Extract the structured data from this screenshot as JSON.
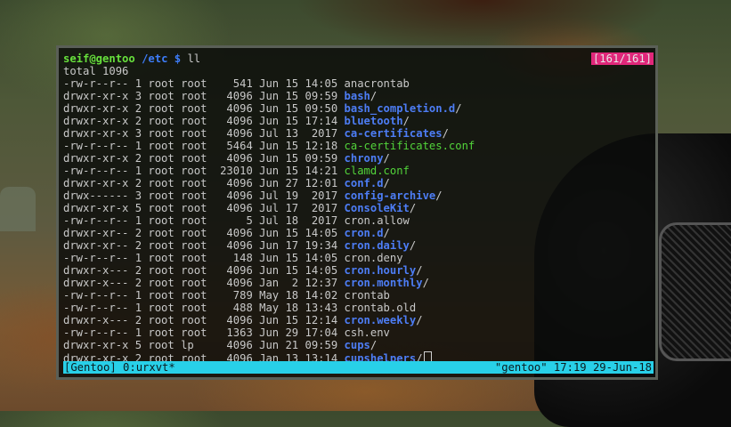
{
  "prompt": {
    "user": "seif@gentoo",
    "path": "/etc $",
    "command": "ll"
  },
  "counter": "[161/161]",
  "total": "total 1096",
  "listing": [
    {
      "meta": "-rw-r--r-- 1 root root    541 Jun 15 14:05 ",
      "name": "anacrontab",
      "suffix": "",
      "type": "file"
    },
    {
      "meta": "drwxr-xr-x 3 root root   4096 Jun 15 09:59 ",
      "name": "bash",
      "suffix": "/",
      "type": "dir"
    },
    {
      "meta": "drwxr-xr-x 2 root root   4096 Jun 15 09:50 ",
      "name": "bash_completion.d",
      "suffix": "/",
      "type": "dir"
    },
    {
      "meta": "drwxr-xr-x 2 root root   4096 Jun 15 17:14 ",
      "name": "bluetooth",
      "suffix": "/",
      "type": "dir"
    },
    {
      "meta": "drwxr-xr-x 3 root root   4096 Jul 13  2017 ",
      "name": "ca-certificates",
      "suffix": "/",
      "type": "dir"
    },
    {
      "meta": "-rw-r--r-- 1 root root   5464 Jun 15 12:18 ",
      "name": "ca-certificates.conf",
      "suffix": "",
      "type": "green"
    },
    {
      "meta": "drwxr-xr-x 2 root root   4096 Jun 15 09:59 ",
      "name": "chrony",
      "suffix": "/",
      "type": "dir"
    },
    {
      "meta": "-rw-r--r-- 1 root root  23010 Jun 15 14:21 ",
      "name": "clamd.conf",
      "suffix": "",
      "type": "green"
    },
    {
      "meta": "drwxr-xr-x 2 root root   4096 Jun 27 12:01 ",
      "name": "conf.d",
      "suffix": "/",
      "type": "dir"
    },
    {
      "meta": "drwx------ 3 root root   4096 Jul 19  2017 ",
      "name": "config-archive",
      "suffix": "/",
      "type": "dir"
    },
    {
      "meta": "drwxr-xr-x 5 root root   4096 Jul 17  2017 ",
      "name": "ConsoleKit",
      "suffix": "/",
      "type": "dir"
    },
    {
      "meta": "-rw-r--r-- 1 root root      5 Jul 18  2017 ",
      "name": "cron.allow",
      "suffix": "",
      "type": "file"
    },
    {
      "meta": "drwxr-xr-- 2 root root   4096 Jun 15 14:05 ",
      "name": "cron.d",
      "suffix": "/",
      "type": "dir"
    },
    {
      "meta": "drwxr-xr-- 2 root root   4096 Jun 17 19:34 ",
      "name": "cron.daily",
      "suffix": "/",
      "type": "dir"
    },
    {
      "meta": "-rw-r--r-- 1 root root    148 Jun 15 14:05 ",
      "name": "cron.deny",
      "suffix": "",
      "type": "file"
    },
    {
      "meta": "drwxr-x--- 2 root root   4096 Jun 15 14:05 ",
      "name": "cron.hourly",
      "suffix": "/",
      "type": "dir"
    },
    {
      "meta": "drwxr-x--- 2 root root   4096 Jan  2 12:37 ",
      "name": "cron.monthly",
      "suffix": "/",
      "type": "dir"
    },
    {
      "meta": "-rw-r--r-- 1 root root    789 May 18 14:02 ",
      "name": "crontab",
      "suffix": "",
      "type": "file"
    },
    {
      "meta": "-rw-r--r-- 1 root root    488 May 18 13:43 ",
      "name": "crontab.old",
      "suffix": "",
      "type": "file"
    },
    {
      "meta": "drwxr-x--- 2 root root   4096 Jun 15 12:14 ",
      "name": "cron.weekly",
      "suffix": "/",
      "type": "dir"
    },
    {
      "meta": "-rw-r--r-- 1 root root   1363 Jun 29 17:04 ",
      "name": "csh.env",
      "suffix": "",
      "type": "file"
    },
    {
      "meta": "drwxr-xr-x 5 root lp     4096 Jun 21 09:59 ",
      "name": "cups",
      "suffix": "/",
      "type": "dir"
    },
    {
      "meta": "drwxr-xr-x 2 root root   4096 Jan 13 13:14 ",
      "name": "cupshelpers",
      "suffix": "/",
      "type": "dir"
    }
  ],
  "status": {
    "left": "[Gentoo] 0:urxvt*",
    "right": "\"gentoo\" 17:19 29-Jun-18"
  }
}
